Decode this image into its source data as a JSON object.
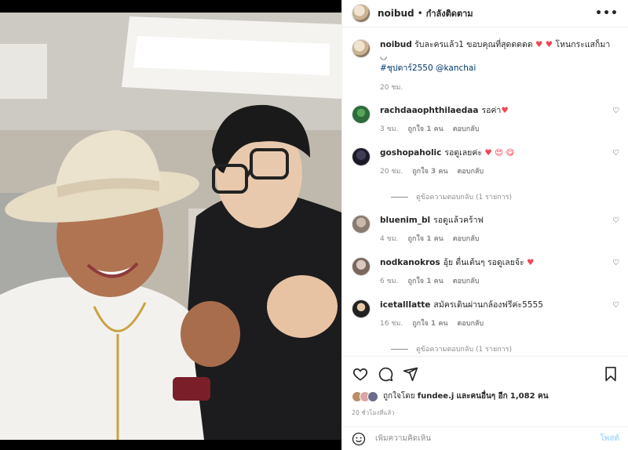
{
  "post": {
    "username": "noibud",
    "follow_status": "กำลังติดตาม",
    "more_label": "•••"
  },
  "caption": {
    "username": "noibud",
    "text": "รับละครแล้ว1 ขอบคุณที่สุดดดดด",
    "text_after": "โหนกระแสก็มา",
    "hashtag": "#ชุปดาร์2550",
    "mention": "@kanchai",
    "time": "20 ชม."
  },
  "comments": [
    {
      "username": "rachdaaophthilaedaa",
      "text": "รอค่า",
      "emoji": "♥",
      "time": "3 ชม.",
      "likes": "ถูกใจ 1 คน",
      "reply": "ตอบกลับ",
      "replies_label": ""
    },
    {
      "username": "goshopaholic",
      "text": "รอดูเลยค่ะ",
      "emoji": "♥ 😍 😋",
      "time": "20 ชม.",
      "likes": "ถูกใจ 3 คน",
      "reply": "ตอบกลับ",
      "replies_label": "ดูข้อความตอบกลับ (1 รายการ)"
    },
    {
      "username": "bluenim_bl",
      "text": "รอดูแล้วคร้าฟ",
      "emoji": "",
      "time": "4 ชม.",
      "likes": "ถูกใจ 1 คน",
      "reply": "ตอบกลับ",
      "replies_label": ""
    },
    {
      "username": "nodkanokros",
      "text": "อุ้ย ตื่นเต้นๆ รอดูเลยจ้ะ",
      "emoji": "♥",
      "time": "6 ชม.",
      "likes": "ถูกใจ 1 คน",
      "reply": "ตอบกลับ",
      "replies_label": ""
    },
    {
      "username": "icetallIatte",
      "text": "สมัครเดินผ่านกล้องฟรีค่ะ5555",
      "emoji": "",
      "time": "16 ชม.",
      "likes": "ถูกใจ 1 คน",
      "reply": "ตอบกลับ",
      "replies_label": "ดูข้อความตอบกลับ (1 รายการ)"
    }
  ],
  "likes": {
    "prefix": "ถูกใจโดย",
    "user": "fundee.j",
    "middle": "และคนอื่นๆ อีก",
    "count": "1,082 คน"
  },
  "post_time": "20 ชั่วโมงที่แล้ว",
  "add_comment": {
    "placeholder": "เพิ่มความคิดเห็น",
    "post_label": "โพสต์"
  },
  "colors": {
    "heart": "#ed4956",
    "link": "#00376b",
    "muted": "#8e8e8e",
    "post_button_disabled": "#b3dbff"
  },
  "icons": [
    "heart-icon",
    "comment-icon",
    "share-icon",
    "bookmark-icon",
    "emoji-icon",
    "more-icon"
  ]
}
